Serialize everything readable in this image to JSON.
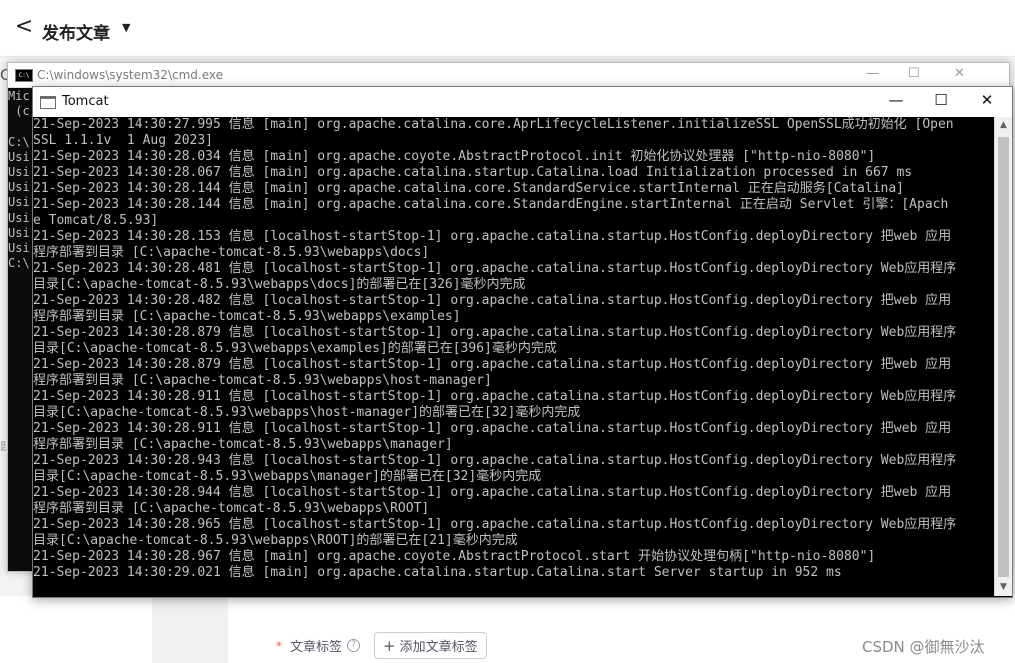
{
  "editor": {
    "back_glyph": "<",
    "title": "发布文章",
    "dropdown_glyph": "▼",
    "tag_required": "*",
    "tag_label": "文章标签",
    "tag_help": "?",
    "add_tag_plus": "+",
    "add_tag_label": "添加文章标签",
    "watermark": "CSDN @御無沙汰"
  },
  "cmd": {
    "title": "C:\\windows\\system32\\cmd.exe",
    "icon_text": "C:\\",
    "minimize": "—",
    "maximize": "☐",
    "close": "✕",
    "visible_lines": [
      "Mic",
      " (c)",
      "",
      "C:\\",
      "Usi",
      "Usi",
      "Usi",
      "Usi",
      "Usi",
      "Usi",
      "Usi",
      "C:\\"
    ]
  },
  "tomcat": {
    "title": "Tomcat",
    "minimize": "—",
    "maximize": "☐",
    "close": "✕",
    "lines": [
      "21-Sep-2023 14:30:27.995 信息 [main] org.apache.catalina.core.AprLifecycleListener.initializeSSL OpenSSL成功初始化 [Open",
      "SSL 1.1.1v  1 Aug 2023]",
      "21-Sep-2023 14:30:28.034 信息 [main] org.apache.coyote.AbstractProtocol.init 初始化协议处理器 [\"http-nio-8080\"]",
      "21-Sep-2023 14:30:28.067 信息 [main] org.apache.catalina.startup.Catalina.load Initialization processed in 667 ms",
      "21-Sep-2023 14:30:28.144 信息 [main] org.apache.catalina.core.StandardService.startInternal 正在启动服务[Catalina]",
      "21-Sep-2023 14:30:28.144 信息 [main] org.apache.catalina.core.StandardEngine.startInternal 正在启动 Servlet 引擎：[Apach",
      "e Tomcat/8.5.93]",
      "21-Sep-2023 14:30:28.153 信息 [localhost-startStop-1] org.apache.catalina.startup.HostConfig.deployDirectory 把web 应用",
      "程序部署到目录 [C:\\apache-tomcat-8.5.93\\webapps\\docs]",
      "21-Sep-2023 14:30:28.481 信息 [localhost-startStop-1] org.apache.catalina.startup.HostConfig.deployDirectory Web应用程序",
      "目录[C:\\apache-tomcat-8.5.93\\webapps\\docs]的部署已在[326]毫秒内完成",
      "21-Sep-2023 14:30:28.482 信息 [localhost-startStop-1] org.apache.catalina.startup.HostConfig.deployDirectory 把web 应用",
      "程序部署到目录 [C:\\apache-tomcat-8.5.93\\webapps\\examples]",
      "21-Sep-2023 14:30:28.879 信息 [localhost-startStop-1] org.apache.catalina.startup.HostConfig.deployDirectory Web应用程序",
      "目录[C:\\apache-tomcat-8.5.93\\webapps\\examples]的部署已在[396]毫秒内完成",
      "21-Sep-2023 14:30:28.879 信息 [localhost-startStop-1] org.apache.catalina.startup.HostConfig.deployDirectory 把web 应用",
      "程序部署到目录 [C:\\apache-tomcat-8.5.93\\webapps\\host-manager]",
      "21-Sep-2023 14:30:28.911 信息 [localhost-startStop-1] org.apache.catalina.startup.HostConfig.deployDirectory Web应用程序",
      "目录[C:\\apache-tomcat-8.5.93\\webapps\\host-manager]的部署已在[32]毫秒内完成",
      "21-Sep-2023 14:30:28.911 信息 [localhost-startStop-1] org.apache.catalina.startup.HostConfig.deployDirectory 把web 应用",
      "程序部署到目录 [C:\\apache-tomcat-8.5.93\\webapps\\manager]",
      "21-Sep-2023 14:30:28.943 信息 [localhost-startStop-1] org.apache.catalina.startup.HostConfig.deployDirectory Web应用程序",
      "目录[C:\\apache-tomcat-8.5.93\\webapps\\manager]的部署已在[32]毫秒内完成",
      "21-Sep-2023 14:30:28.944 信息 [localhost-startStop-1] org.apache.catalina.startup.HostConfig.deployDirectory 把web 应用",
      "程序部署到目录 [C:\\apache-tomcat-8.5.93\\webapps\\ROOT]",
      "21-Sep-2023 14:30:28.965 信息 [localhost-startStop-1] org.apache.catalina.startup.HostConfig.deployDirectory Web应用程序",
      "目录[C:\\apache-tomcat-8.5.93\\webapps\\ROOT]的部署已在[21]毫秒内完成",
      "21-Sep-2023 14:30:28.967 信息 [main] org.apache.coyote.AbstractProtocol.start 开始协议处理句柄[\"http-nio-8080\"]",
      "21-Sep-2023 14:30:29.021 信息 [main] org.apache.catalina.startup.Catalina.start Server startup in 952 ms"
    ],
    "scroll_up": "▲",
    "scroll_down": "▼"
  }
}
